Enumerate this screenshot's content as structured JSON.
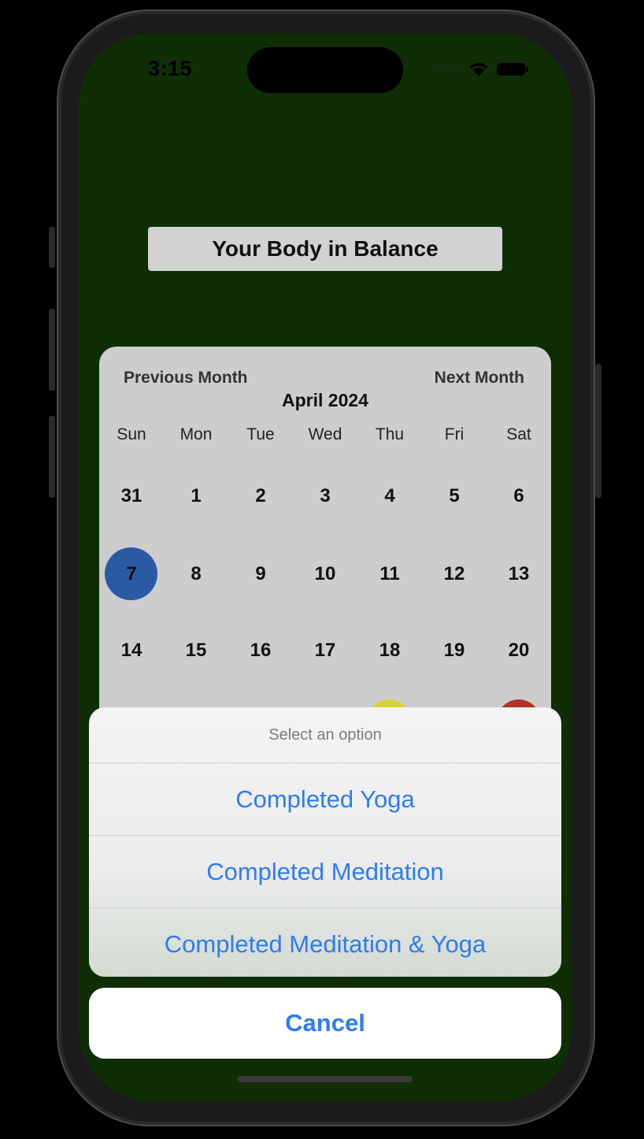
{
  "status": {
    "time": "3:15",
    "icons": [
      "signal-dots-icon",
      "wifi-icon",
      "battery-icon"
    ]
  },
  "app": {
    "title": "Your Body in Balance"
  },
  "calendar": {
    "prev_label": "Previous Month",
    "next_label": "Next Month",
    "month_label": "April 2024",
    "weekdays": [
      "Sun",
      "Mon",
      "Tue",
      "Wed",
      "Thu",
      "Fri",
      "Sat"
    ],
    "weeks": [
      [
        "31",
        "1",
        "2",
        "3",
        "4",
        "5",
        "6"
      ],
      [
        "7",
        "8",
        "9",
        "10",
        "11",
        "12",
        "13"
      ],
      [
        "14",
        "15",
        "16",
        "17",
        "18",
        "19",
        "20"
      ]
    ],
    "selected_day": "7",
    "colors": {
      "selected": "#2b5aa4",
      "yoga_marker": "#d8d23a",
      "meditation_marker": "#b03228"
    }
  },
  "action_sheet": {
    "title": "Select an option",
    "options": [
      "Completed Yoga",
      "Completed Meditation",
      "Completed Meditation & Yoga"
    ],
    "cancel_label": "Cancel"
  },
  "colors": {
    "background": "#0f2e05",
    "accent": "#2e7cf0"
  }
}
